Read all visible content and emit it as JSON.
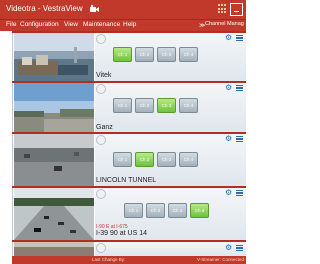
{
  "app": {
    "title": "Videotra - VestraView",
    "logo_icon": "camera-logo-icon"
  },
  "menu": {
    "items": [
      "File",
      "Configuration",
      "View",
      "Maintenance",
      "Help"
    ],
    "channel_manager": "Channel Manag"
  },
  "feeds": [
    {
      "name": "Vitek",
      "channels": [
        "Ch 1",
        "Ch 2",
        "Ch 3",
        "Ch 4"
      ],
      "active_channel": 1
    },
    {
      "name": "Ganz",
      "channels": [
        "Ch 1",
        "Ch 2",
        "Ch 3",
        "Ch 4"
      ],
      "active_channel": 3
    },
    {
      "name": "LINCOLN TUNNEL",
      "channels": [
        "Ch 1",
        "Ch 2",
        "Ch 3",
        "Ch 4"
      ],
      "active_channel": 2
    },
    {
      "name": "I-39 90 at US 14",
      "overlay": "I-90 E at I-675",
      "channels": [
        "Ch 1",
        "Ch 2",
        "Ch 3",
        "Ch 4"
      ],
      "active_channel": 4
    }
  ],
  "status": {
    "left": "Last Change By:",
    "right": "V-Streamer: Connected"
  },
  "colors": {
    "accent": "#c0392b",
    "active_channel": "#7fd04a",
    "icon_blue": "#2b6cb0"
  }
}
